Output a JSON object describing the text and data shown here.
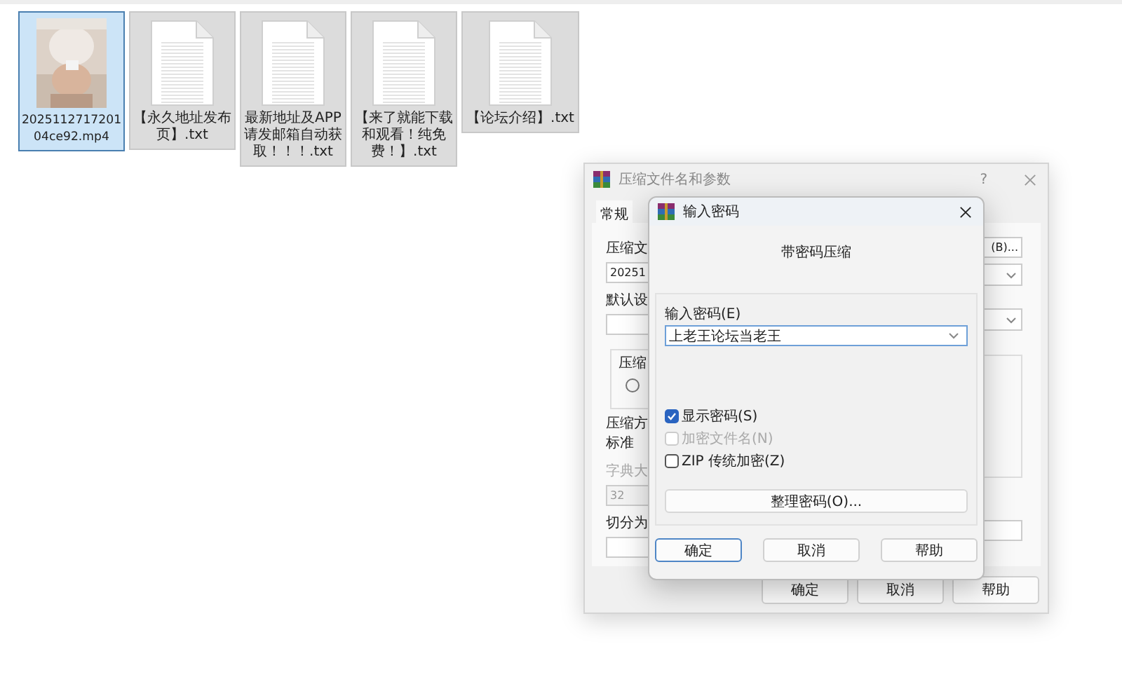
{
  "files": [
    {
      "name": "202511271720104ce92.mp4",
      "kind": "video",
      "selected": true
    },
    {
      "name": "【永久地址发布页】.txt",
      "kind": "text",
      "selected": false
    },
    {
      "name": "最新地址及APP请发邮箱自动获取！！！.txt",
      "kind": "text",
      "selected": false
    },
    {
      "name": "【来了就能下载和观看！纯免费！】.txt",
      "kind": "text",
      "selected": false
    },
    {
      "name": "【论坛介绍】.txt",
      "kind": "text",
      "selected": false
    }
  ],
  "archive_dialog": {
    "title": "压缩文件名和参数",
    "help": "?",
    "tabs": [
      {
        "label": "常规",
        "selected": true
      }
    ],
    "left_items": [
      {
        "kind": "label",
        "text": "压缩文"
      },
      {
        "kind": "input",
        "text": "20251"
      },
      {
        "kind": "label",
        "text": "默认设"
      },
      {
        "kind": "select"
      },
      {
        "kind": "group",
        "text": "压缩",
        "checked": false
      },
      {
        "kind": "label",
        "text": "压缩方"
      },
      {
        "kind": "value",
        "text": "标准"
      },
      {
        "kind": "label",
        "text": "字典大",
        "disabled": true
      },
      {
        "kind": "input",
        "text": "32",
        "disabled": true
      },
      {
        "kind": "label",
        "text": "切分为"
      },
      {
        "kind": "input"
      }
    ],
    "browse_button": "(B)...",
    "buttons": [
      "确定",
      "取消",
      "帮助"
    ]
  },
  "password_dialog": {
    "title": "输入密码",
    "heading": "带密码压缩",
    "password_label": "输入密码(E)",
    "password": "上老王论坛当老王",
    "options": [
      {
        "label": "显示密码(S)",
        "checked": true,
        "disabled": false
      },
      {
        "label": "加密文件名(N)",
        "checked": false,
        "disabled": true
      },
      {
        "label": "ZIP 传统加密(Z)",
        "checked": false,
        "disabled": false
      }
    ],
    "organize_button": "整理密码(O)...",
    "buttons": [
      {
        "label": "确定",
        "default": true
      },
      {
        "label": "取消",
        "default": false
      },
      {
        "label": "帮助",
        "default": false
      }
    ]
  }
}
